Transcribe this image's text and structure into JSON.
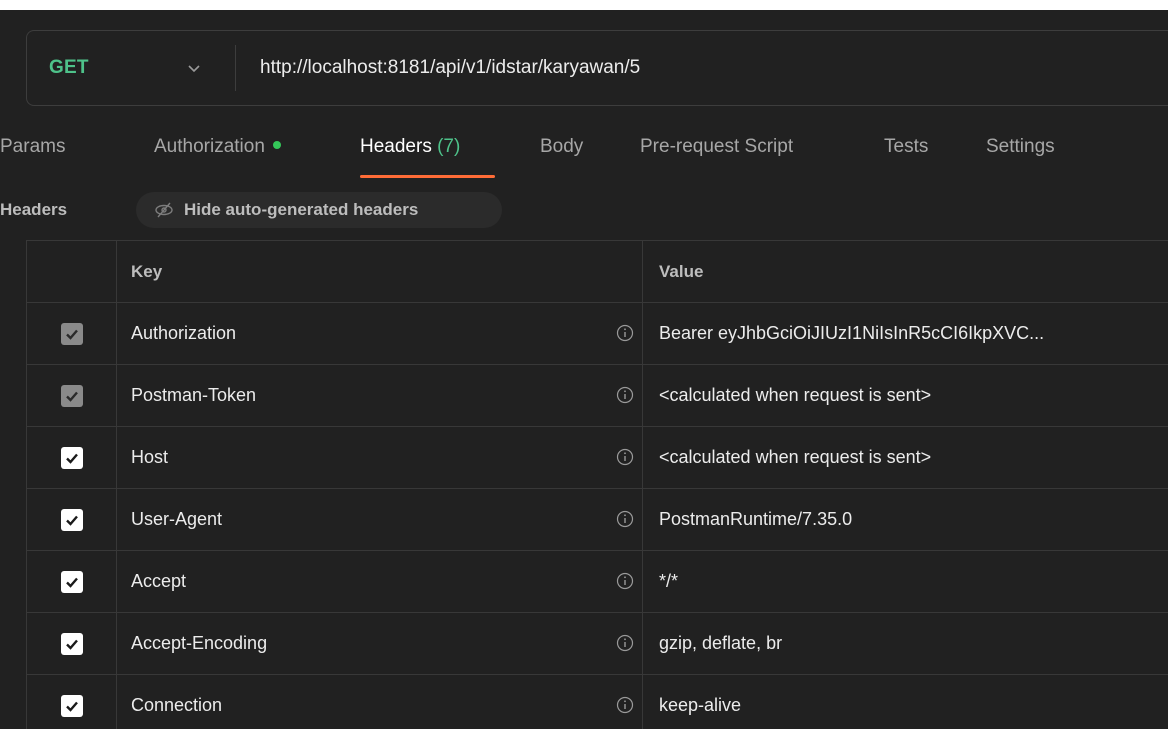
{
  "request": {
    "method": "GET",
    "url": "http://localhost:8181/api/v1/idstar/karyawan/5"
  },
  "tabs": [
    {
      "label": "Params"
    },
    {
      "label": "Authorization"
    },
    {
      "label": "Headers",
      "count": "(7)"
    },
    {
      "label": "Body"
    },
    {
      "label": "Pre-request Script"
    },
    {
      "label": "Tests"
    },
    {
      "label": "Settings"
    }
  ],
  "headers_bar": {
    "title": "Headers",
    "hide_button": "Hide auto-generated headers"
  },
  "table": {
    "columns": {
      "key": "Key",
      "value": "Value"
    },
    "rows": [
      {
        "key": "Authorization",
        "value": "Bearer eyJhbGciOiJIUzI1NiIsInR5cCI6IkpXVC...",
        "checkbox": "disabled"
      },
      {
        "key": "Postman-Token",
        "value": "<calculated when request is sent>",
        "checkbox": "disabled"
      },
      {
        "key": "Host",
        "value": "<calculated when request is sent>",
        "checkbox": "checked"
      },
      {
        "key": "User-Agent",
        "value": "PostmanRuntime/7.35.0",
        "checkbox": "checked"
      },
      {
        "key": "Accept",
        "value": "*/*",
        "checkbox": "checked"
      },
      {
        "key": "Accept-Encoding",
        "value": "gzip, deflate, br",
        "checkbox": "checked"
      },
      {
        "key": "Connection",
        "value": "keep-alive",
        "checkbox": "checked"
      }
    ]
  },
  "colors": {
    "method_get": "#4ec28a",
    "active_tab_underline": "#ff6c37",
    "auth_dot": "#34c759",
    "background": "#212121"
  },
  "icons": {
    "method_dropdown": "chevron-down-icon",
    "hide_headers": "eye-off-icon",
    "row_info": "info-icon",
    "checkbox": "checkmark-icon"
  }
}
